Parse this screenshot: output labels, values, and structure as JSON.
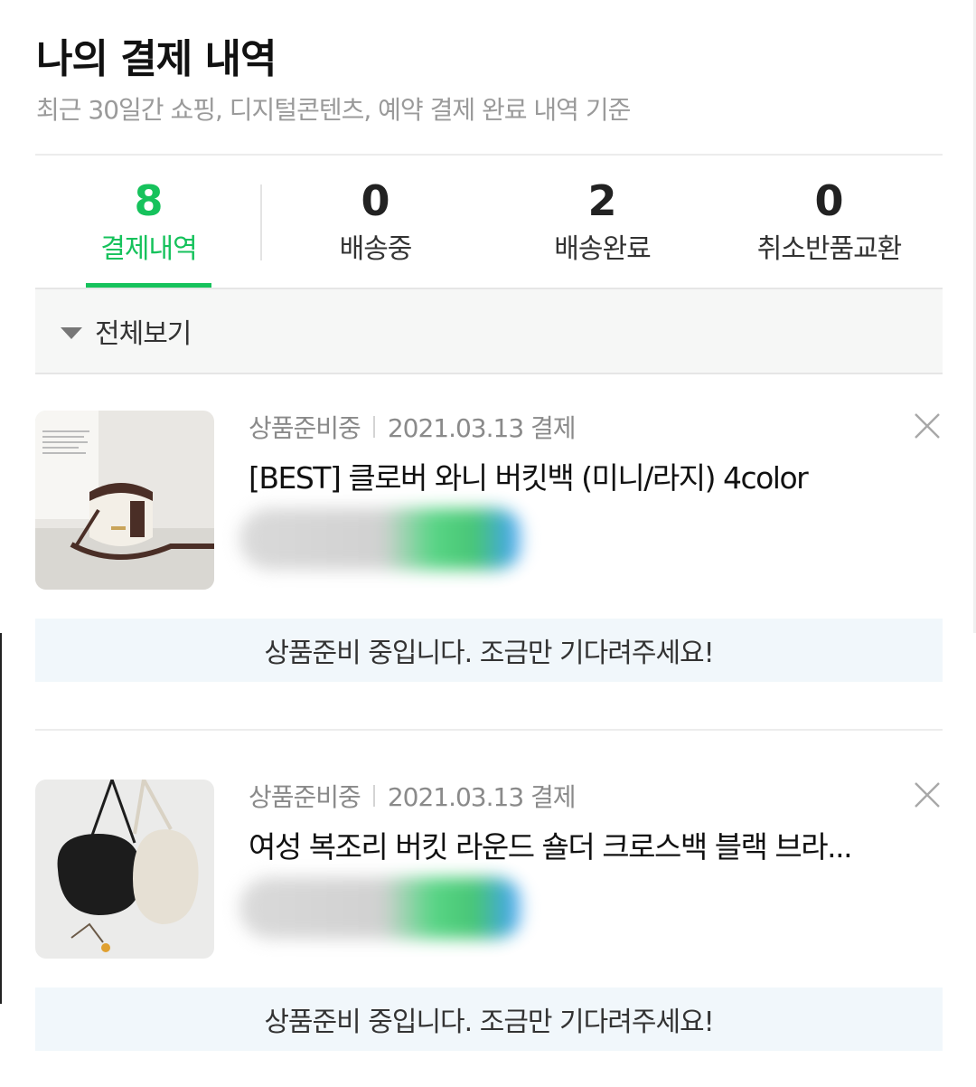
{
  "header": {
    "title": "나의 결제 내역",
    "subtitle": "최근 30일간 쇼핑, 디지털콘텐츠, 예약 결제 완료 내역 기준"
  },
  "tabs": [
    {
      "count": "8",
      "label": "결제내역",
      "active": true
    },
    {
      "count": "0",
      "label": "배송중",
      "active": false
    },
    {
      "count": "2",
      "label": "배송완료",
      "active": false
    },
    {
      "count": "0",
      "label": "취소반품교환",
      "active": false
    }
  ],
  "filter": {
    "label": "전체보기",
    "icon": "caret-down-icon"
  },
  "orders": [
    {
      "status": "상품준비중",
      "date": "2021.03.13 결제",
      "name": "[BEST] 클로버 와니 버킷백 (미니/라지) 4color",
      "notice": "상품준비 중입니다. 조금만 기다려주세요!",
      "thumbnail": "cream-brown-bucket-bag"
    },
    {
      "status": "상품준비중",
      "date": "2021.03.13 결제",
      "name": "여성 복조리 버킷 라운드 숄더 크로스백 블랙 브라...",
      "notice": "상품준비 중입니다. 조금만 기다려주세요!",
      "thumbnail": "black-beige-round-bags"
    }
  ],
  "colors": {
    "accent": "#16c25c",
    "notice_bg": "#f1f7fb",
    "filter_bg": "#f6f7f6"
  }
}
